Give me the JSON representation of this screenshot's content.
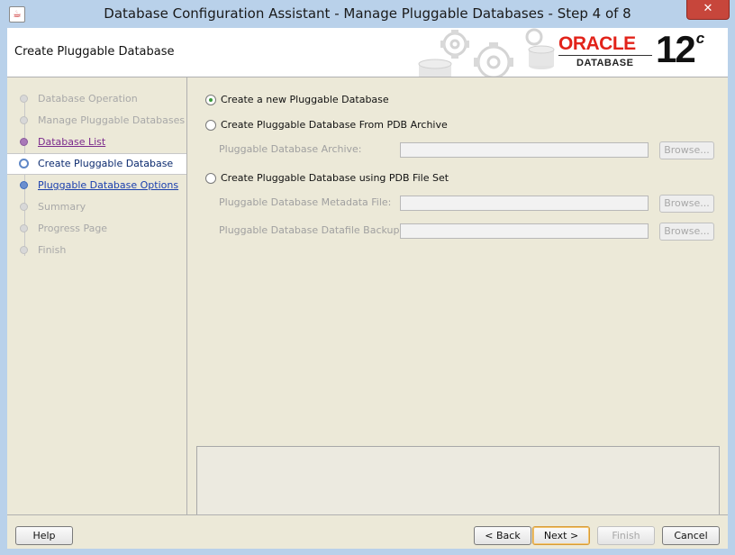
{
  "window": {
    "title": "Database Configuration Assistant - Manage Pluggable Databases - Step 4 of 8",
    "close_symbol": "✕"
  },
  "header": {
    "title": "Create Pluggable Database",
    "logo_brand": "ORACLE",
    "logo_product": "DATABASE",
    "logo_version": "12",
    "logo_version_suffix": "c"
  },
  "sidebar": {
    "items": [
      {
        "label": "Database Operation",
        "state": "disabled"
      },
      {
        "label": "Manage Pluggable Databases",
        "state": "disabled"
      },
      {
        "label": "Database List",
        "state": "visited"
      },
      {
        "label": "Create Pluggable Database",
        "state": "current"
      },
      {
        "label": "Pluggable Database Options",
        "state": "link"
      },
      {
        "label": "Summary",
        "state": "disabled"
      },
      {
        "label": "Progress Page",
        "state": "disabled"
      },
      {
        "label": "Finish",
        "state": "disabled"
      }
    ]
  },
  "main": {
    "option_new": "Create a new Pluggable Database",
    "option_archive": "Create Pluggable Database From PDB Archive",
    "archive_label": "Pluggable Database Archive:",
    "archive_value": "",
    "option_fileset": "Create Pluggable Database using PDB File Set",
    "metadata_label": "Pluggable Database Metadata File:",
    "metadata_value": "",
    "datafile_label": "Pluggable Database Datafile Backup:",
    "datafile_value": "",
    "browse_label": "Browse...",
    "selected_option": "new"
  },
  "footer": {
    "help": "Help",
    "back": "< Back",
    "next": "Next >",
    "finish": "Finish",
    "cancel": "Cancel"
  },
  "colors": {
    "accent_red": "#e2231a",
    "link_blue": "#1a3fae",
    "visited_purple": "#7b2a8c",
    "title_bar": "#b9d1ea",
    "close_button": "#c7463b"
  }
}
